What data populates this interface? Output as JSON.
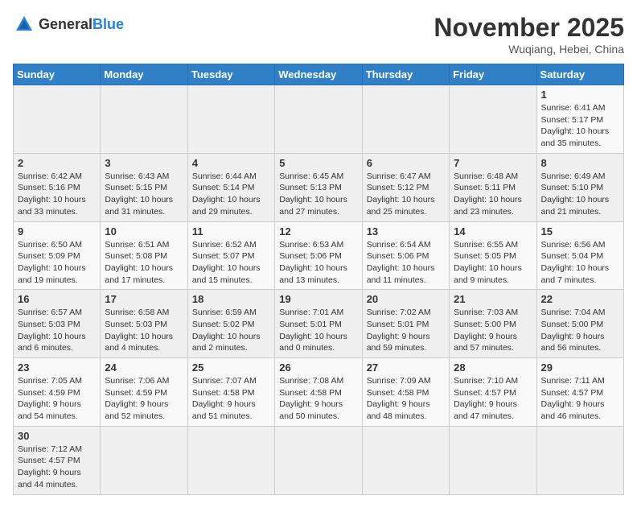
{
  "logo": {
    "text_general": "General",
    "text_blue": "Blue"
  },
  "title": "November 2025",
  "subtitle": "Wuqiang, Hebei, China",
  "weekdays": [
    "Sunday",
    "Monday",
    "Tuesday",
    "Wednesday",
    "Thursday",
    "Friday",
    "Saturday"
  ],
  "weeks": [
    [
      {
        "day": "",
        "info": ""
      },
      {
        "day": "",
        "info": ""
      },
      {
        "day": "",
        "info": ""
      },
      {
        "day": "",
        "info": ""
      },
      {
        "day": "",
        "info": ""
      },
      {
        "day": "",
        "info": ""
      },
      {
        "day": "1",
        "info": "Sunrise: 6:41 AM\nSunset: 5:17 PM\nDaylight: 10 hours and 35 minutes."
      }
    ],
    [
      {
        "day": "2",
        "info": "Sunrise: 6:42 AM\nSunset: 5:16 PM\nDaylight: 10 hours and 33 minutes."
      },
      {
        "day": "3",
        "info": "Sunrise: 6:43 AM\nSunset: 5:15 PM\nDaylight: 10 hours and 31 minutes."
      },
      {
        "day": "4",
        "info": "Sunrise: 6:44 AM\nSunset: 5:14 PM\nDaylight: 10 hours and 29 minutes."
      },
      {
        "day": "5",
        "info": "Sunrise: 6:45 AM\nSunset: 5:13 PM\nDaylight: 10 hours and 27 minutes."
      },
      {
        "day": "6",
        "info": "Sunrise: 6:47 AM\nSunset: 5:12 PM\nDaylight: 10 hours and 25 minutes."
      },
      {
        "day": "7",
        "info": "Sunrise: 6:48 AM\nSunset: 5:11 PM\nDaylight: 10 hours and 23 minutes."
      },
      {
        "day": "8",
        "info": "Sunrise: 6:49 AM\nSunset: 5:10 PM\nDaylight: 10 hours and 21 minutes."
      }
    ],
    [
      {
        "day": "9",
        "info": "Sunrise: 6:50 AM\nSunset: 5:09 PM\nDaylight: 10 hours and 19 minutes."
      },
      {
        "day": "10",
        "info": "Sunrise: 6:51 AM\nSunset: 5:08 PM\nDaylight: 10 hours and 17 minutes."
      },
      {
        "day": "11",
        "info": "Sunrise: 6:52 AM\nSunset: 5:07 PM\nDaylight: 10 hours and 15 minutes."
      },
      {
        "day": "12",
        "info": "Sunrise: 6:53 AM\nSunset: 5:06 PM\nDaylight: 10 hours and 13 minutes."
      },
      {
        "day": "13",
        "info": "Sunrise: 6:54 AM\nSunset: 5:06 PM\nDaylight: 10 hours and 11 minutes."
      },
      {
        "day": "14",
        "info": "Sunrise: 6:55 AM\nSunset: 5:05 PM\nDaylight: 10 hours and 9 minutes."
      },
      {
        "day": "15",
        "info": "Sunrise: 6:56 AM\nSunset: 5:04 PM\nDaylight: 10 hours and 7 minutes."
      }
    ],
    [
      {
        "day": "16",
        "info": "Sunrise: 6:57 AM\nSunset: 5:03 PM\nDaylight: 10 hours and 6 minutes."
      },
      {
        "day": "17",
        "info": "Sunrise: 6:58 AM\nSunset: 5:03 PM\nDaylight: 10 hours and 4 minutes."
      },
      {
        "day": "18",
        "info": "Sunrise: 6:59 AM\nSunset: 5:02 PM\nDaylight: 10 hours and 2 minutes."
      },
      {
        "day": "19",
        "info": "Sunrise: 7:01 AM\nSunset: 5:01 PM\nDaylight: 10 hours and 0 minutes."
      },
      {
        "day": "20",
        "info": "Sunrise: 7:02 AM\nSunset: 5:01 PM\nDaylight: 9 hours and 59 minutes."
      },
      {
        "day": "21",
        "info": "Sunrise: 7:03 AM\nSunset: 5:00 PM\nDaylight: 9 hours and 57 minutes."
      },
      {
        "day": "22",
        "info": "Sunrise: 7:04 AM\nSunset: 5:00 PM\nDaylight: 9 hours and 56 minutes."
      }
    ],
    [
      {
        "day": "23",
        "info": "Sunrise: 7:05 AM\nSunset: 4:59 PM\nDaylight: 9 hours and 54 minutes."
      },
      {
        "day": "24",
        "info": "Sunrise: 7:06 AM\nSunset: 4:59 PM\nDaylight: 9 hours and 52 minutes."
      },
      {
        "day": "25",
        "info": "Sunrise: 7:07 AM\nSunset: 4:58 PM\nDaylight: 9 hours and 51 minutes."
      },
      {
        "day": "26",
        "info": "Sunrise: 7:08 AM\nSunset: 4:58 PM\nDaylight: 9 hours and 50 minutes."
      },
      {
        "day": "27",
        "info": "Sunrise: 7:09 AM\nSunset: 4:58 PM\nDaylight: 9 hours and 48 minutes."
      },
      {
        "day": "28",
        "info": "Sunrise: 7:10 AM\nSunset: 4:57 PM\nDaylight: 9 hours and 47 minutes."
      },
      {
        "day": "29",
        "info": "Sunrise: 7:11 AM\nSunset: 4:57 PM\nDaylight: 9 hours and 46 minutes."
      }
    ],
    [
      {
        "day": "30",
        "info": "Sunrise: 7:12 AM\nSunset: 4:57 PM\nDaylight: 9 hours and 44 minutes."
      },
      {
        "day": "",
        "info": ""
      },
      {
        "day": "",
        "info": ""
      },
      {
        "day": "",
        "info": ""
      },
      {
        "day": "",
        "info": ""
      },
      {
        "day": "",
        "info": ""
      },
      {
        "day": "",
        "info": ""
      }
    ]
  ]
}
